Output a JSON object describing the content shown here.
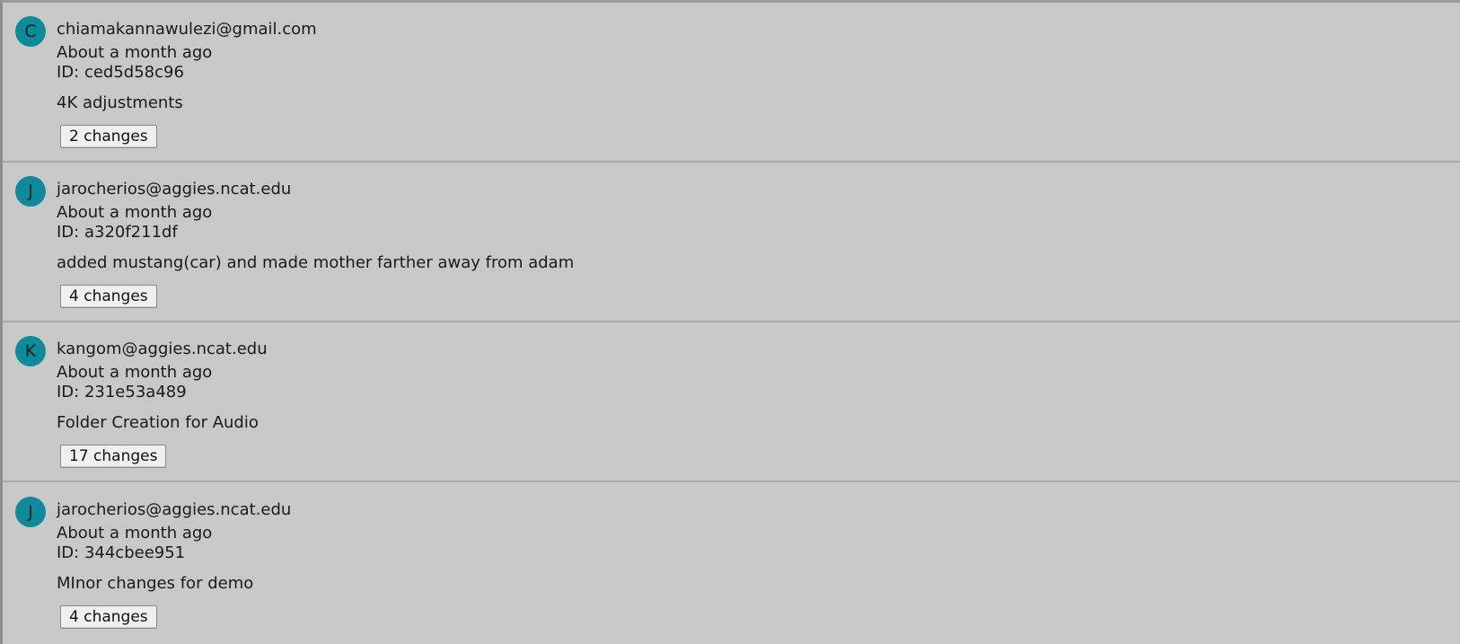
{
  "commits": [
    {
      "avatar_letter": "C",
      "email": "chiamakannawulezi@gmail.com",
      "time": "About a month ago",
      "id_text": "ID: ced5d58c96",
      "message": "4K adjustments",
      "changes_label": "2 changes"
    },
    {
      "avatar_letter": "J",
      "email": "jarocherios@aggies.ncat.edu",
      "time": "About a month ago",
      "id_text": "ID: a320f211df",
      "message": "added mustang(car) and made mother farther away from adam",
      "changes_label": "4 changes"
    },
    {
      "avatar_letter": "K",
      "email": "kangom@aggies.ncat.edu",
      "time": "About a month ago",
      "id_text": "ID: 231e53a489",
      "message": "Folder Creation for Audio",
      "changes_label": "17 changes"
    },
    {
      "avatar_letter": "J",
      "email": "jarocherios@aggies.ncat.edu",
      "time": "About a month ago",
      "id_text": "ID: 344cbee951",
      "message": "MInor changes for demo",
      "changes_label": "4 changes"
    }
  ],
  "colors": {
    "background": "#c8c8c8",
    "avatar": "#0f8a9a",
    "separator": "#a8a8a8",
    "button": "#efefef"
  }
}
